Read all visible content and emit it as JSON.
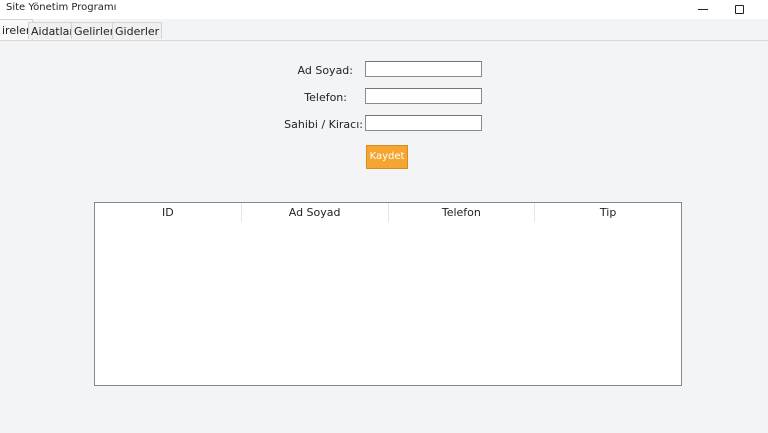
{
  "window": {
    "title": "Site Yönetim Programı"
  },
  "tabs": [
    {
      "label": "ireler",
      "active": true
    },
    {
      "label": "Aidatlar",
      "active": false
    },
    {
      "label": "Gelirler",
      "active": false
    },
    {
      "label": "Giderler",
      "active": false
    }
  ],
  "form": {
    "name_label": "Ad Soyad:",
    "name_value": "",
    "phone_label": "Telefon:",
    "phone_value": "",
    "owner_label": "Sahibi / Kiracı:",
    "owner_value": "",
    "save_label": "Kaydet"
  },
  "table": {
    "columns": [
      "ID",
      "Ad Soyad",
      "Telefon",
      "Tip"
    ],
    "rows": []
  },
  "colors": {
    "save_button": "#f4a532",
    "background": "#f3f4f6"
  },
  "icons": {
    "minimize": "minimize-icon",
    "maximize": "maximize-icon"
  }
}
